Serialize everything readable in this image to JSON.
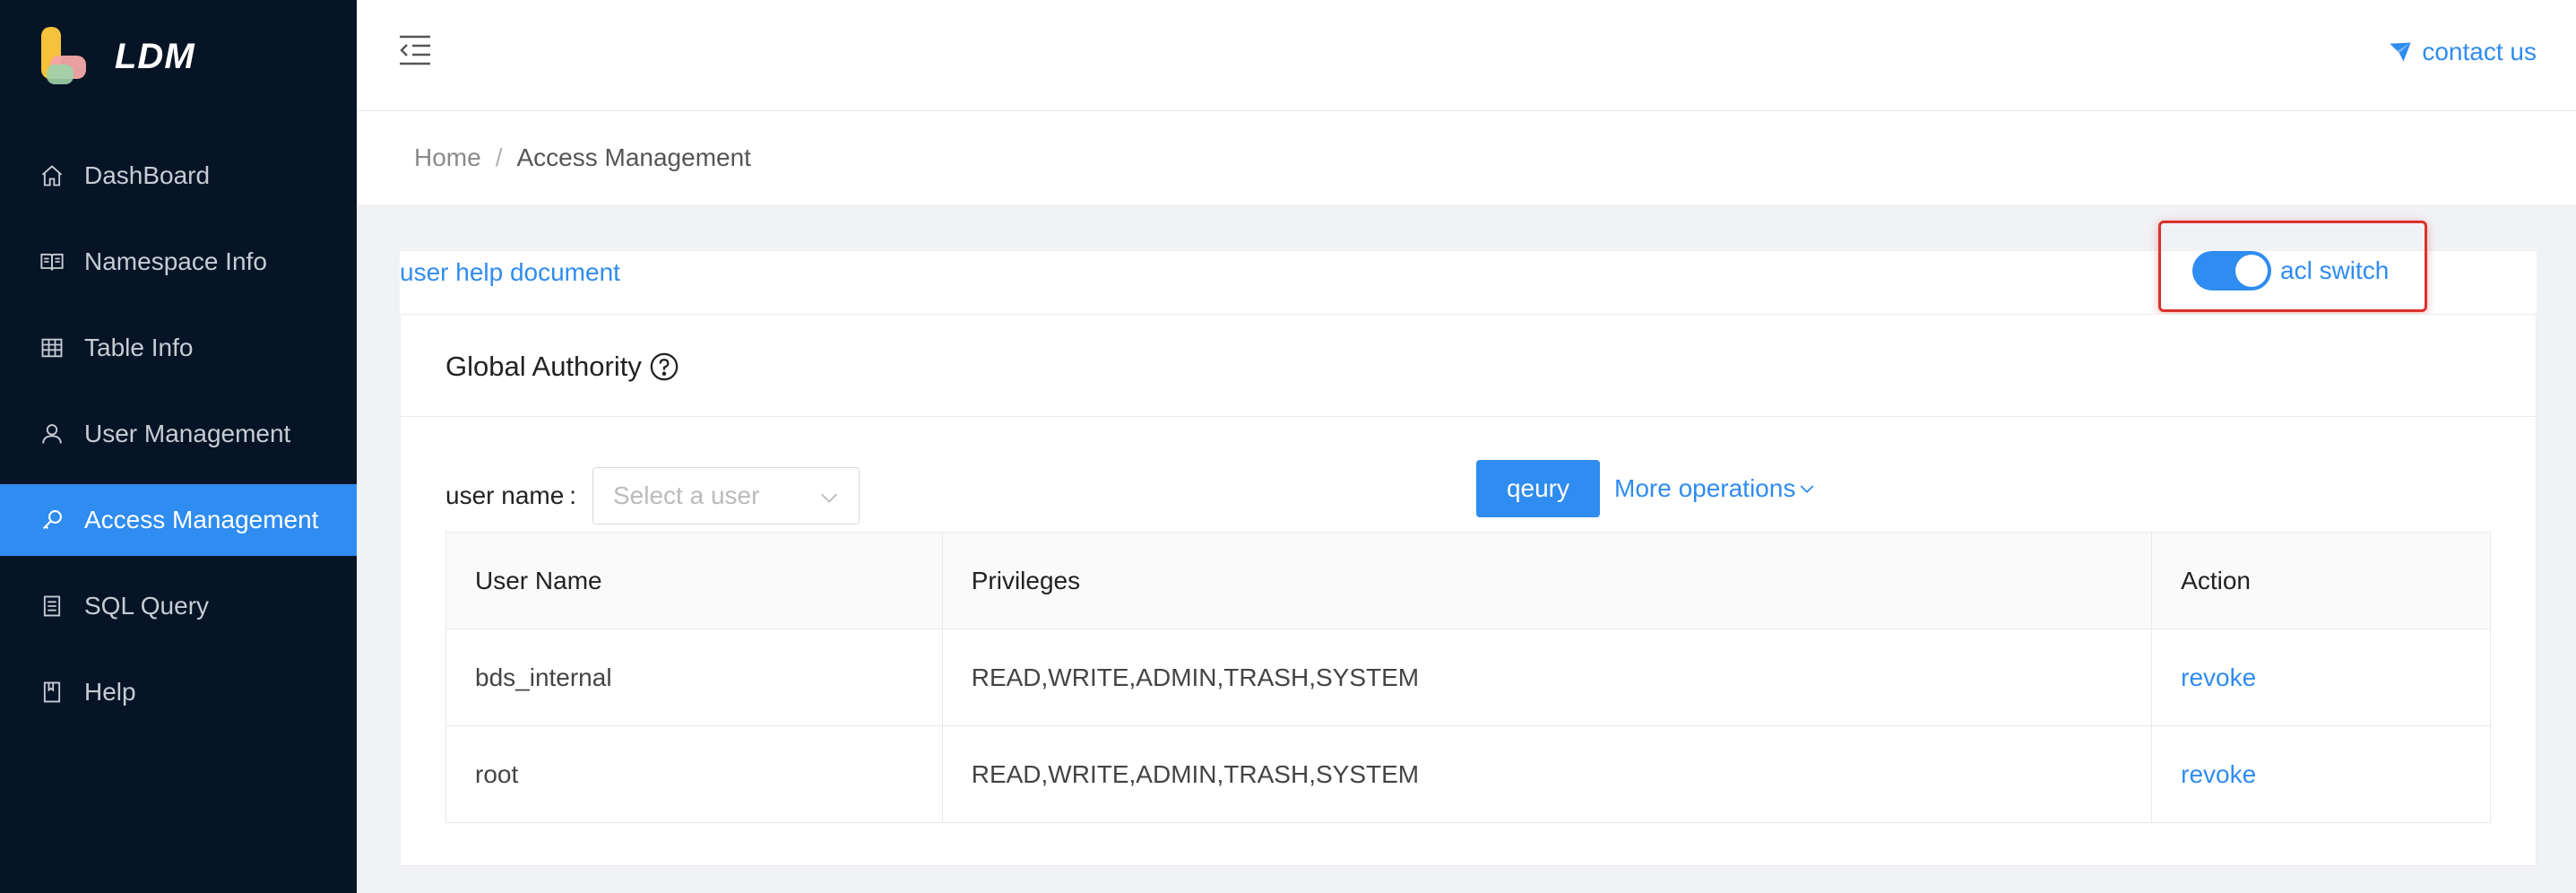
{
  "app": {
    "name": "LDM"
  },
  "sidebar": {
    "items": [
      {
        "label": "DashBoard",
        "icon": "home-icon"
      },
      {
        "label": "Namespace Info",
        "icon": "book-icon"
      },
      {
        "label": "Table Info",
        "icon": "table-icon"
      },
      {
        "label": "User Management",
        "icon": "user-icon"
      },
      {
        "label": "Access Management",
        "icon": "key-icon",
        "active": true
      },
      {
        "label": "SQL Query",
        "icon": "document-icon"
      },
      {
        "label": "Help",
        "icon": "bookmark-icon"
      }
    ]
  },
  "header": {
    "contact_label": "contact us"
  },
  "breadcrumb": {
    "home": "Home",
    "separator": "/",
    "current": "Access Management"
  },
  "content": {
    "help_link": "user help document",
    "acl_label": "acl switch",
    "acl_on": true,
    "card_title": "Global Authority",
    "filter": {
      "label": "user name",
      "colon": ":",
      "placeholder": "Select a user"
    },
    "query_button": "qeury",
    "more_operations": "More operations"
  },
  "table": {
    "headers": [
      "User Name",
      "Privileges",
      "Action"
    ],
    "rows": [
      {
        "user": "bds_internal",
        "privileges": "READ,WRITE,ADMIN,TRASH,SYSTEM",
        "action": "revoke"
      },
      {
        "user": "root",
        "privileges": "READ,WRITE,ADMIN,TRASH,SYSTEM",
        "action": "revoke"
      }
    ]
  },
  "colors": {
    "sidebar_bg": "#071426",
    "accent": "#2f8cf0",
    "highlight_border": "#d9322a"
  }
}
